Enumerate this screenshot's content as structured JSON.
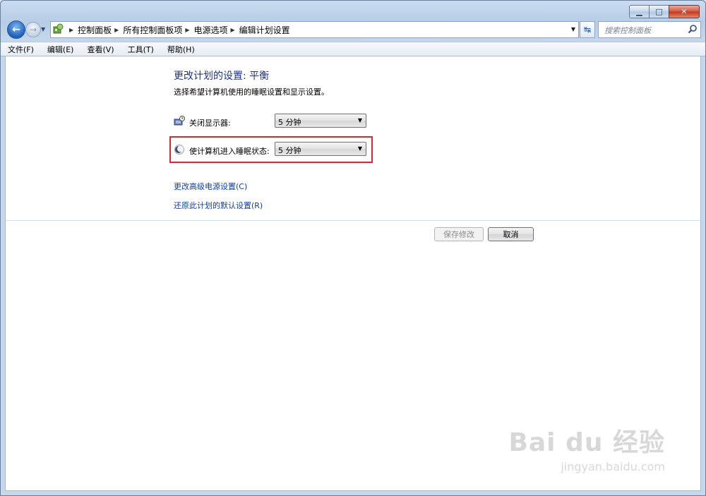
{
  "window": {
    "caption_buttons": [
      "minimize-icon",
      "maximize-icon",
      "close-icon"
    ]
  },
  "address": {
    "breadcrumbs": [
      "控制面板",
      "所有控制面板项",
      "电源选项",
      "编辑计划设置"
    ],
    "search_placeholder": "搜索控制面板"
  },
  "menu": {
    "items": [
      "文件(F)",
      "编辑(E)",
      "查看(V)",
      "工具(T)",
      "帮助(H)"
    ]
  },
  "main": {
    "title": "更改计划的设置: 平衡",
    "subtitle": "选择希望计算机使用的睡眠设置和显示设置。",
    "settings": [
      {
        "label": "关闭显示器:",
        "value": "5 分钟",
        "icon": "monitor-clock-icon"
      },
      {
        "label": "使计算机进入睡眠状态:",
        "value": "5 分钟",
        "icon": "moon-icon"
      }
    ],
    "links": [
      "更改高级电源设置(C)",
      "还原此计划的默认设置(R)"
    ],
    "buttons": {
      "save": "保存修改",
      "cancel": "取消"
    },
    "highlight_color": "#e2252b",
    "link_color": "#0c3ea8",
    "title_color": "#1e3287"
  },
  "watermark": {
    "main": "Bai du 经验",
    "sub": "jingyan.baidu.com"
  }
}
